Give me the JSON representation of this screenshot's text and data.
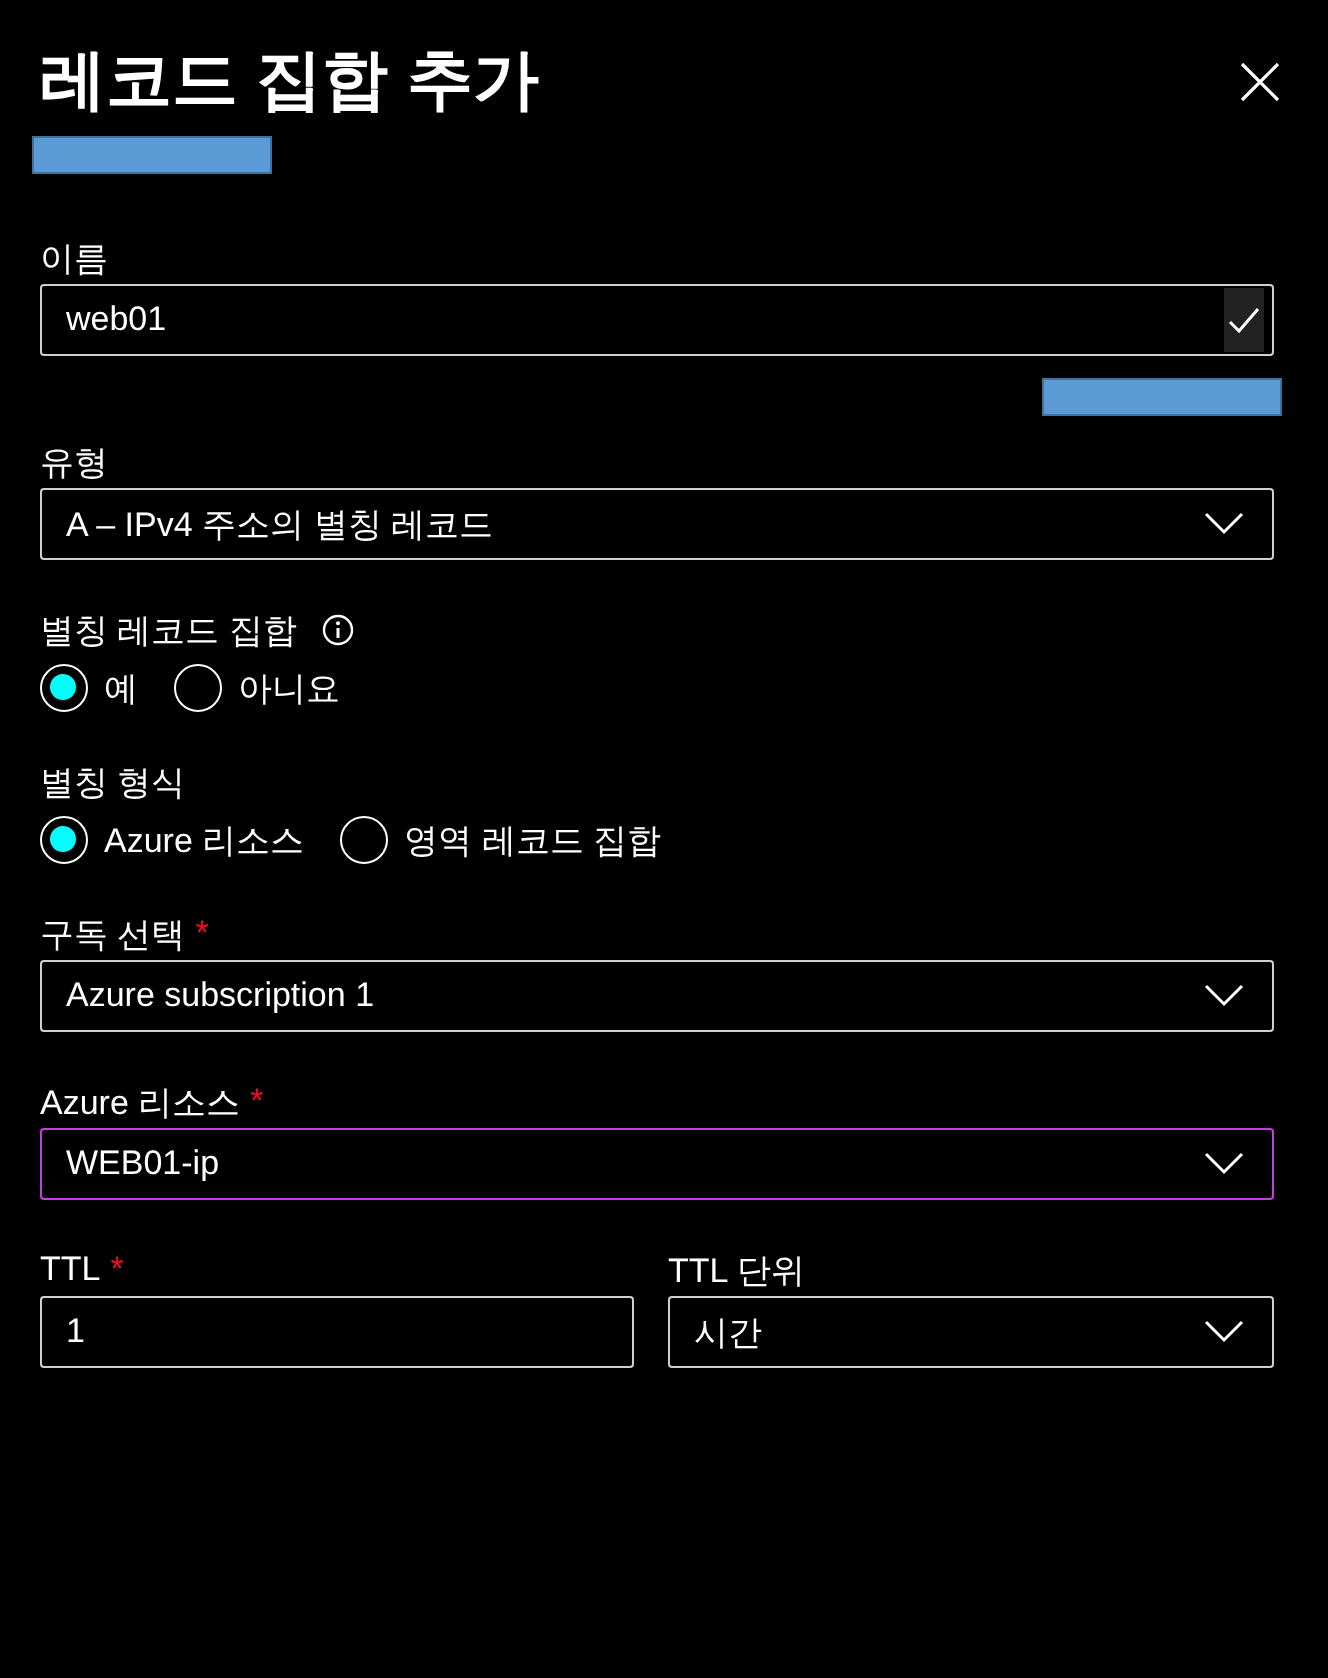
{
  "title": "레코드 집합 추가",
  "fields": [
    {
      "kind": "text",
      "label": "이름",
      "value": "web01",
      "valid": true
    },
    {
      "kind": "select",
      "label": "유형",
      "value": "A – IPv4 주소의 별칭 레코드"
    },
    {
      "kind": "radio",
      "label": "별칭 레코드 집합",
      "info": true,
      "options": [
        {
          "label": "예",
          "selected": true
        },
        {
          "label": "아니요",
          "selected": false
        }
      ]
    },
    {
      "kind": "radio",
      "label": "별칭 형식",
      "options": [
        {
          "label": "Azure 리소스",
          "selected": true
        },
        {
          "label": "영역 레코드 집합",
          "selected": false
        }
      ]
    },
    {
      "kind": "select",
      "label": "구독 선택",
      "required_mark": "*",
      "value": "Azure subscription 1"
    },
    {
      "kind": "select",
      "label": "Azure 리소스",
      "required_mark": "*",
      "value": "WEB01-ip",
      "focused": true
    },
    {
      "kind": "pair",
      "fields": [
        {
          "kind": "text",
          "label": "TTL",
          "required_mark": "*",
          "value": "1"
        },
        {
          "kind": "select",
          "label": "TTL 단위",
          "value": "시간"
        }
      ]
    }
  ]
}
